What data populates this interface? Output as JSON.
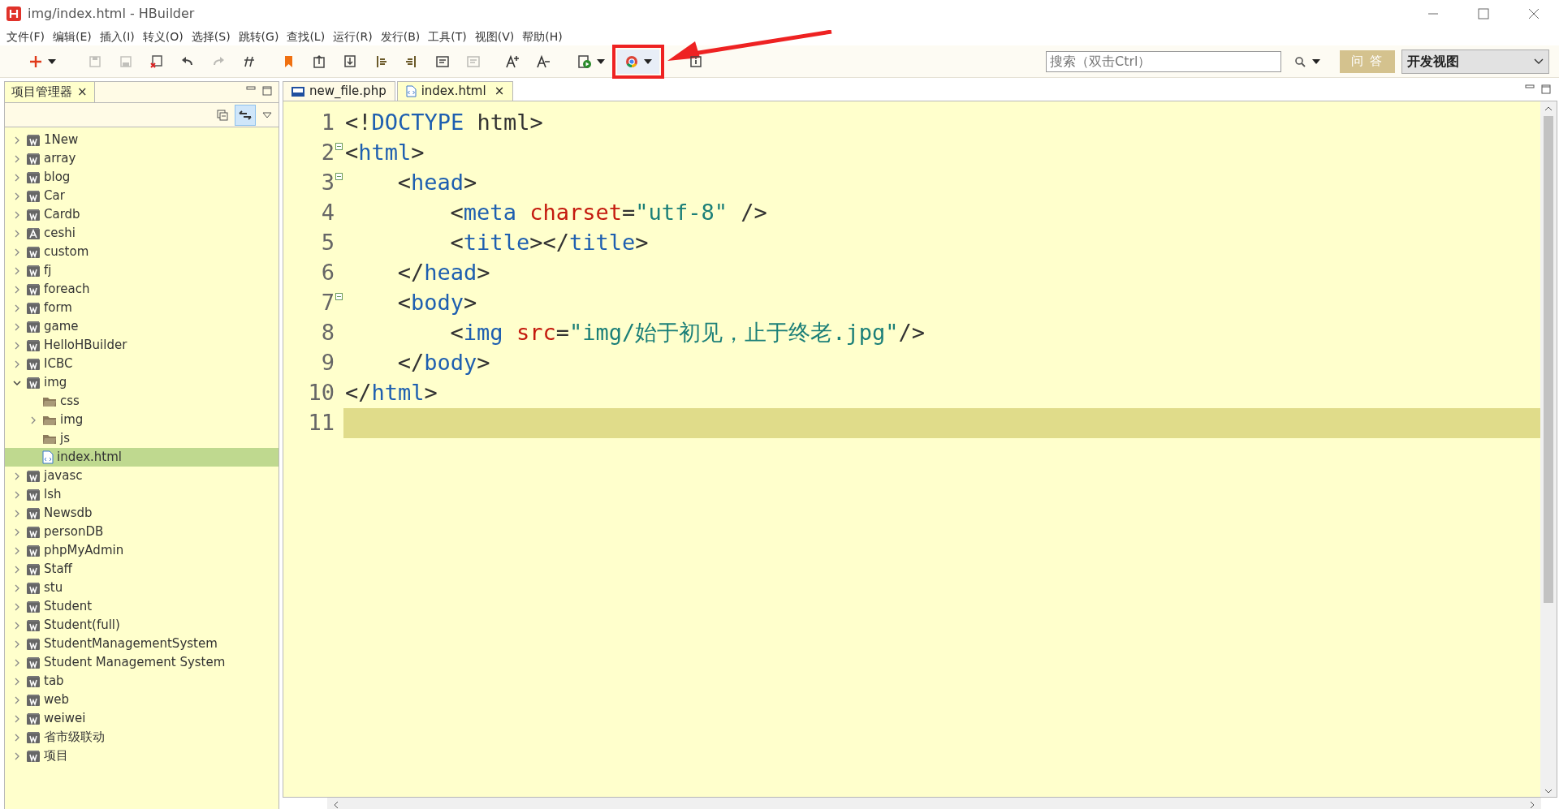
{
  "window": {
    "title": "img/index.html  -  HBuilder"
  },
  "menu": [
    "文件(F)",
    "编辑(E)",
    "插入(I)",
    "转义(O)",
    "选择(S)",
    "跳转(G)",
    "查找(L)",
    "运行(R)",
    "发行(B)",
    "工具(T)",
    "视图(V)",
    "帮助(H)"
  ],
  "toolbar": [
    {
      "disabled": false,
      "dropdown": true,
      "highlighted": false
    },
    {
      "disabled": true,
      "dropdown": false,
      "highlighted": false
    },
    {
      "disabled": true,
      "dropdown": false,
      "highlighted": false
    },
    {
      "disabled": false,
      "dropdown": false,
      "highlighted": false
    },
    {
      "disabled": false,
      "dropdown": false,
      "highlighted": false
    },
    {
      "disabled": true,
      "dropdown": false,
      "highlighted": false
    },
    {
      "disabled": false,
      "dropdown": false,
      "highlighted": false
    },
    {
      "disabled": false,
      "dropdown": false,
      "highlighted": false
    },
    {
      "disabled": false,
      "dropdown": false,
      "highlighted": false
    },
    {
      "disabled": false,
      "dropdown": false,
      "highlighted": false
    },
    {
      "disabled": false,
      "dropdown": false,
      "highlighted": false
    },
    {
      "disabled": false,
      "dropdown": false,
      "highlighted": false
    },
    {
      "disabled": false,
      "dropdown": false,
      "highlighted": false
    },
    {
      "disabled": true,
      "dropdown": false,
      "highlighted": false
    },
    {
      "disabled": false,
      "dropdown": false,
      "highlighted": false
    },
    {
      "disabled": false,
      "dropdown": false,
      "highlighted": false
    },
    {
      "disabled": false,
      "dropdown": true,
      "highlighted": false
    },
    {
      "disabled": false,
      "dropdown": true,
      "highlighted": true
    },
    {
      "disabled": false,
      "dropdown": false,
      "highlighted": false
    }
  ],
  "search": {
    "placeholder": "搜索（双击Ctrl）"
  },
  "qa_button": "问 答",
  "view_select": "开发视图",
  "project_panel": {
    "title": "项目管理器",
    "close": "×",
    "tree": [
      {
        "label": "1New",
        "kind": "web",
        "expandable": true,
        "expanded": false,
        "selected": false
      },
      {
        "label": "array",
        "kind": "web",
        "expandable": true,
        "expanded": false,
        "selected": false
      },
      {
        "label": "blog",
        "kind": "web",
        "expandable": true,
        "expanded": false,
        "selected": false
      },
      {
        "label": "Car",
        "kind": "web",
        "expandable": true,
        "expanded": false,
        "selected": false
      },
      {
        "label": "Cardb",
        "kind": "web",
        "expandable": true,
        "expanded": false,
        "selected": false
      },
      {
        "label": "ceshi",
        "kind": "app",
        "expandable": true,
        "expanded": false,
        "selected": false
      },
      {
        "label": "custom",
        "kind": "web",
        "expandable": true,
        "expanded": false,
        "selected": false
      },
      {
        "label": "fj",
        "kind": "web",
        "expandable": true,
        "expanded": false,
        "selected": false
      },
      {
        "label": "foreach",
        "kind": "web",
        "expandable": true,
        "expanded": false,
        "selected": false
      },
      {
        "label": "form",
        "kind": "web",
        "expandable": true,
        "expanded": false,
        "selected": false
      },
      {
        "label": "game",
        "kind": "web",
        "expandable": true,
        "expanded": false,
        "selected": false
      },
      {
        "label": "HelloHBuilder",
        "kind": "web",
        "expandable": true,
        "expanded": false,
        "selected": false
      },
      {
        "label": "ICBC",
        "kind": "web",
        "expandable": true,
        "expanded": false,
        "selected": false
      },
      {
        "label": "img",
        "kind": "web",
        "expandable": true,
        "expanded": true,
        "selected": false,
        "children": [
          {
            "label": "css",
            "kind": "folder",
            "expandable": false,
            "selected": false
          },
          {
            "label": "img",
            "kind": "folder",
            "expandable": true,
            "expanded": false,
            "selected": false
          },
          {
            "label": "js",
            "kind": "folder",
            "expandable": false,
            "selected": false
          },
          {
            "label": "index.html",
            "kind": "file",
            "expandable": false,
            "selected": true
          }
        ]
      },
      {
        "label": "javasc",
        "kind": "web",
        "expandable": true,
        "expanded": false,
        "selected": false
      },
      {
        "label": "lsh",
        "kind": "web",
        "expandable": true,
        "expanded": false,
        "selected": false
      },
      {
        "label": "Newsdb",
        "kind": "web",
        "expandable": true,
        "expanded": false,
        "selected": false
      },
      {
        "label": "personDB",
        "kind": "web",
        "expandable": true,
        "expanded": false,
        "selected": false
      },
      {
        "label": "phpMyAdmin",
        "kind": "web",
        "expandable": true,
        "expanded": false,
        "selected": false
      },
      {
        "label": "Staff",
        "kind": "web",
        "expandable": true,
        "expanded": false,
        "selected": false
      },
      {
        "label": "stu",
        "kind": "web",
        "expandable": true,
        "expanded": false,
        "selected": false
      },
      {
        "label": "Student",
        "kind": "web",
        "expandable": true,
        "expanded": false,
        "selected": false
      },
      {
        "label": "Student(full)",
        "kind": "web",
        "expandable": true,
        "expanded": false,
        "selected": false
      },
      {
        "label": "StudentManagementSystem",
        "kind": "web",
        "expandable": true,
        "expanded": false,
        "selected": false
      },
      {
        "label": "Student Management System",
        "kind": "web",
        "expandable": true,
        "expanded": false,
        "selected": false
      },
      {
        "label": "tab",
        "kind": "web",
        "expandable": true,
        "expanded": false,
        "selected": false
      },
      {
        "label": "web",
        "kind": "web",
        "expandable": true,
        "expanded": false,
        "selected": false
      },
      {
        "label": "weiwei",
        "kind": "web",
        "expandable": true,
        "expanded": false,
        "selected": false
      },
      {
        "label": "省市级联动",
        "kind": "web",
        "expandable": true,
        "expanded": false,
        "selected": false
      },
      {
        "label": "项目",
        "kind": "web",
        "expandable": true,
        "expanded": false,
        "selected": false
      }
    ]
  },
  "editor": {
    "tabs": [
      {
        "label": "new_file.php",
        "kind": "php",
        "selected": false
      },
      {
        "label": "index.html",
        "kind": "html",
        "selected": true,
        "close": "×"
      }
    ],
    "lines": [
      {
        "number": "1",
        "foldable": false,
        "current": false,
        "tokens": [
          {
            "kind": "punct",
            "text": "<!"
          },
          {
            "kind": "tag",
            "text": "DOCTYPE"
          },
          {
            "kind": "plain",
            "text": " html"
          },
          {
            "kind": "punct",
            "text": ">"
          }
        ]
      },
      {
        "number": "2",
        "foldable": true,
        "current": false,
        "tokens": [
          {
            "kind": "punct",
            "text": "<"
          },
          {
            "kind": "tag",
            "text": "html"
          },
          {
            "kind": "punct",
            "text": ">"
          }
        ],
        "children": [
          {
            "number": "3",
            "foldable": true,
            "current": false,
            "tokens": [
              {
                "kind": "punct",
                "text": "<"
              },
              {
                "kind": "tag",
                "text": "head"
              },
              {
                "kind": "punct",
                "text": ">"
              }
            ],
            "children": [
              {
                "number": "4",
                "foldable": false,
                "current": false,
                "tokens": [
                  {
                    "kind": "punct",
                    "text": "<"
                  },
                  {
                    "kind": "tag",
                    "text": "meta"
                  },
                  {
                    "kind": "attr",
                    "text": " charset"
                  },
                  {
                    "kind": "punct",
                    "text": "="
                  },
                  {
                    "kind": "string",
                    "text": "\"utf-8\""
                  },
                  {
                    "kind": "punct",
                    "text": " />"
                  }
                ]
              },
              {
                "number": "5",
                "foldable": false,
                "current": false,
                "tokens": [
                  {
                    "kind": "punct",
                    "text": "<"
                  },
                  {
                    "kind": "tag",
                    "text": "title"
                  },
                  {
                    "kind": "punct",
                    "text": "></"
                  },
                  {
                    "kind": "tag",
                    "text": "title"
                  },
                  {
                    "kind": "punct",
                    "text": ">"
                  }
                ]
              }
            ]
          },
          {
            "number": "6",
            "foldable": false,
            "current": false,
            "tokens": [
              {
                "kind": "punct",
                "text": "</"
              },
              {
                "kind": "tag",
                "text": "head"
              },
              {
                "kind": "punct",
                "text": ">"
              }
            ]
          },
          {
            "number": "7",
            "foldable": true,
            "current": false,
            "tokens": [
              {
                "kind": "punct",
                "text": "<"
              },
              {
                "kind": "tag",
                "text": "body"
              },
              {
                "kind": "punct",
                "text": ">"
              }
            ],
            "children": [
              {
                "number": "8",
                "foldable": false,
                "current": false,
                "tokens": [
                  {
                    "kind": "punct",
                    "text": "<"
                  },
                  {
                    "kind": "tag",
                    "text": "img"
                  },
                  {
                    "kind": "attr",
                    "text": " src"
                  },
                  {
                    "kind": "punct",
                    "text": "="
                  },
                  {
                    "kind": "string",
                    "text": "\"img/始于初见，止于终老.jpg\""
                  },
                  {
                    "kind": "punct",
                    "text": "/>"
                  }
                ]
              }
            ]
          },
          {
            "number": "9",
            "foldable": false,
            "current": false,
            "tokens": [
              {
                "kind": "punct",
                "text": "</"
              },
              {
                "kind": "tag",
                "text": "body"
              },
              {
                "kind": "punct",
                "text": ">"
              }
            ]
          }
        ]
      },
      {
        "number": "10",
        "foldable": false,
        "current": false,
        "tokens": [
          {
            "kind": "punct",
            "text": "</"
          },
          {
            "kind": "tag",
            "text": "html"
          },
          {
            "kind": "punct",
            "text": ">"
          }
        ]
      },
      {
        "number": "11",
        "foldable": false,
        "current": true
      }
    ]
  }
}
